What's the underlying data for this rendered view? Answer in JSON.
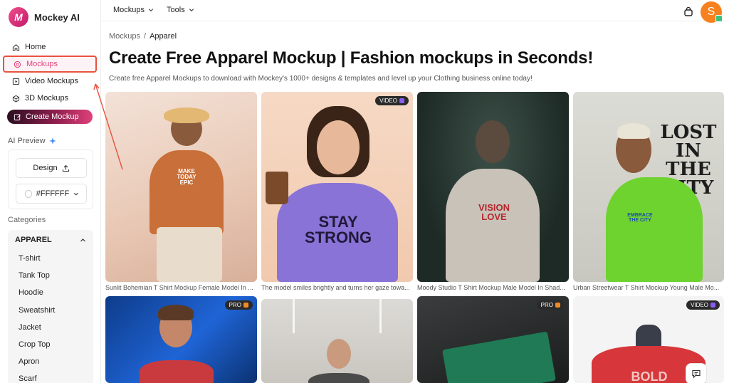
{
  "app": {
    "name": "Mockey AI",
    "logo_letter": "M"
  },
  "sidebar": {
    "nav": [
      {
        "label": "Home",
        "icon": "home-icon"
      },
      {
        "label": "Mockups",
        "icon": "mockups-icon",
        "active": true
      },
      {
        "label": "Video Mockups",
        "icon": "video-icon"
      },
      {
        "label": "3D Mockups",
        "icon": "cube-icon"
      }
    ],
    "create_label": "Create Mockup",
    "ai_preview_label": "AI Preview",
    "design_label": "Design",
    "color_value": "#FFFFFF",
    "categories_label": "Categories",
    "category_group": "APPAREL",
    "category_items": [
      "T-shirt",
      "Tank Top",
      "Hoodie",
      "Sweatshirt",
      "Jacket",
      "Crop Top",
      "Apron",
      "Scarf"
    ]
  },
  "topbar": {
    "menus": [
      "Mockups",
      "Tools"
    ],
    "avatar_initial": "S"
  },
  "breadcrumb": {
    "root": "Mockups",
    "separator": "/",
    "current": "Apparel"
  },
  "main": {
    "title": "Create Free Apparel Mockup | Fashion mockups in Seconds!",
    "subtitle": "Create free Apparel Mockups to download with Mockey's 1000+ designs & templates and level up your Clothing business online today!"
  },
  "cards": [
    {
      "caption": "Sunlit Bohemian T Shirt Mockup Female Model In ...",
      "badge": "",
      "shirt_text": "MAKE\nTODAY\nEPIC"
    },
    {
      "caption": "The model smiles brightly and turns her gaze towa...",
      "badge": "VIDEO",
      "shirt_text": "STAY\nSTRONG"
    },
    {
      "caption": "Moody Studio T Shirt Mockup Male Model In Shad...",
      "badge": "",
      "shirt_text": "VISION\nLOVE"
    },
    {
      "caption": "Urban Streetwear T Shirt Mockup Young Male Mo...",
      "badge": "",
      "shirt_text": "EMBRACE\nTHE CITY",
      "wall_text": "LOST IN\nTHE CITY"
    },
    {
      "caption": "",
      "badge": "PRO"
    },
    {
      "caption": "",
      "badge": ""
    },
    {
      "caption": "",
      "badge": "PRO"
    },
    {
      "caption": "",
      "badge": "VIDEO",
      "shirt_text": "BOLD"
    }
  ],
  "colors": {
    "brand": "#e0407a",
    "annotation": "#e8523f",
    "avatar": "#f7811f"
  }
}
